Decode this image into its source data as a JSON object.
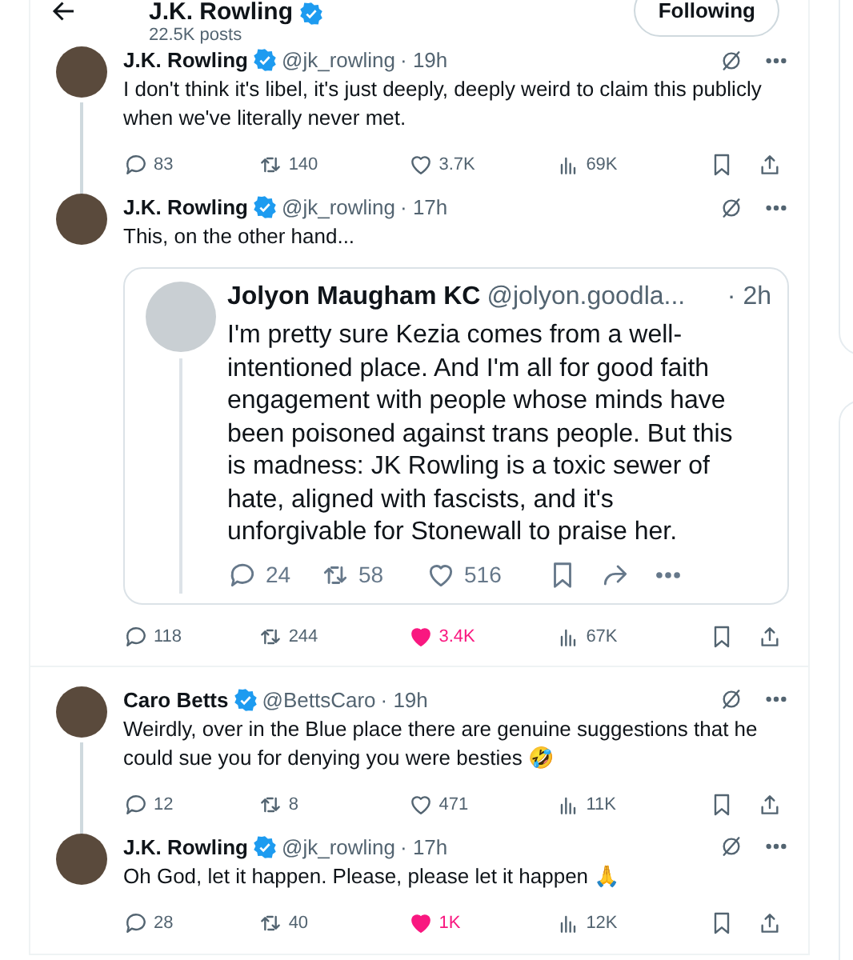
{
  "header": {
    "title": "J.K. Rowling",
    "posts_count": "22.5K posts",
    "follow_button": "Following"
  },
  "posts": [
    {
      "name": "J.K. Rowling",
      "verified": true,
      "handle": "@jk_rowling",
      "time": "· 19h",
      "text": "I don't think it's libel, it's just deeply, deeply weird to claim this publicly when we've literally never met.",
      "thread_line": true,
      "separator_above": false,
      "stats": {
        "replies": "83",
        "reposts": "140",
        "likes": "3.7K",
        "liked": false,
        "views": "69K"
      }
    },
    {
      "name": "J.K. Rowling",
      "verified": true,
      "handle": "@jk_rowling",
      "time": "· 17h",
      "text": "This, on the other hand...",
      "thread_line": false,
      "separator_above": false,
      "quote": {
        "name": "Jolyon Maugham KC",
        "handle": "@jolyon.goodla...",
        "time": "· 2h",
        "text": "I'm pretty sure Kezia comes from a well-intentioned place. And I'm all for good faith engagement with people whose minds have been poisoned against trans people. But this is madness: JK Rowling is a toxic sewer of hate, aligned with fascists, and it's unforgivable for Stonewall to praise her.",
        "replies": "24",
        "reposts": "58",
        "likes": "516"
      },
      "stats": {
        "replies": "118",
        "reposts": "244",
        "likes": "3.4K",
        "liked": true,
        "views": "67K"
      }
    },
    {
      "name": "Caro Betts",
      "verified": true,
      "handle": "@BettsCaro",
      "time": "· 19h",
      "text": "Weirdly, over in the Blue place there are genuine suggestions that he could sue you for denying you were besties 🤣",
      "thread_line": true,
      "separator_above": true,
      "stats": {
        "replies": "12",
        "reposts": "8",
        "likes": "471",
        "liked": false,
        "views": "11K"
      }
    },
    {
      "name": "J.K. Rowling",
      "verified": true,
      "handle": "@jk_rowling",
      "time": "· 17h",
      "text": "Oh God, let it happen. Please, please let it happen 🙏",
      "thread_line": false,
      "separator_above": false,
      "stats": {
        "replies": "28",
        "reposts": "40",
        "likes": "1K",
        "liked": true,
        "views": "12K"
      }
    }
  ]
}
